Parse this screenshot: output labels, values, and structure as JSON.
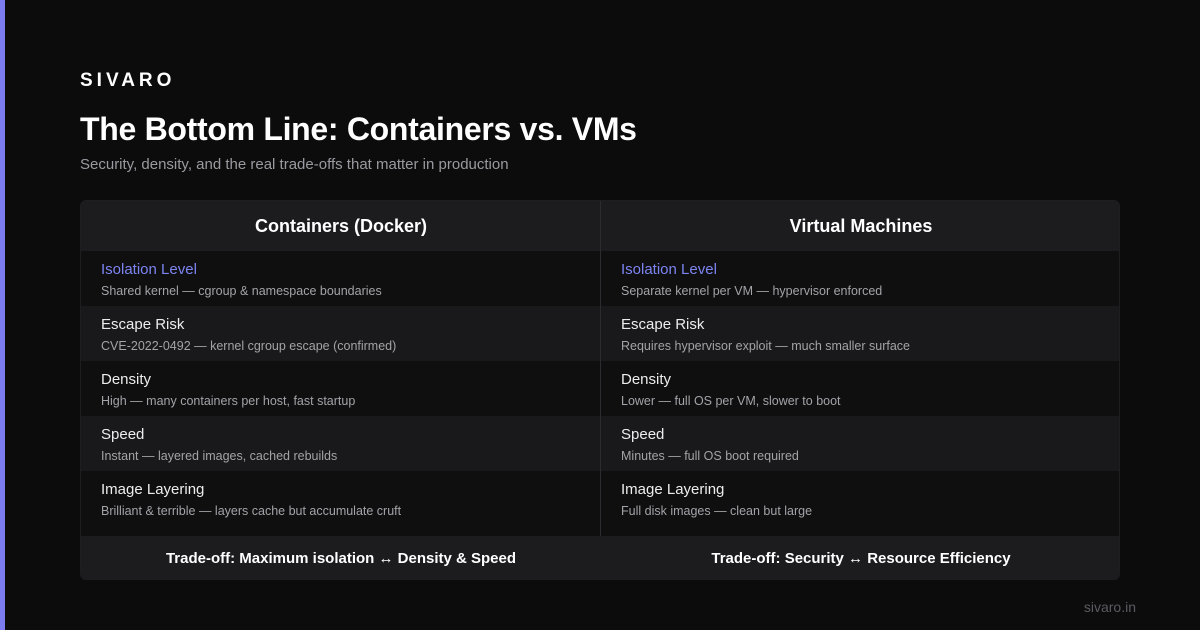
{
  "brand": "SIVARO",
  "title": "The Bottom Line: Containers vs. VMs",
  "subtitle": "Security, density, and the real trade-offs that matter in production",
  "columns": {
    "left": {
      "header": "Containers (Docker)",
      "rows": [
        {
          "label": "Isolation Level",
          "desc": "Shared kernel — cgroup & namespace boundaries"
        },
        {
          "label": "Escape Risk",
          "desc": "CVE-2022-0492 — kernel cgroup escape (confirmed)"
        },
        {
          "label": "Density",
          "desc": "High — many containers per host, fast startup"
        },
        {
          "label": "Speed",
          "desc": "Instant — layered images, cached rebuilds"
        },
        {
          "label": "Image Layering",
          "desc": "Brilliant & terrible — layers cache but accumulate cruft"
        }
      ],
      "footer": "Trade-off: Maximum isolation ↔ Density & Speed"
    },
    "right": {
      "header": "Virtual Machines",
      "rows": [
        {
          "label": "Isolation Level",
          "desc": "Separate kernel per VM — hypervisor enforced"
        },
        {
          "label": "Escape Risk",
          "desc": "Requires hypervisor exploit — much smaller surface"
        },
        {
          "label": "Density",
          "desc": "Lower — full OS per VM, slower to boot"
        },
        {
          "label": "Speed",
          "desc": "Minutes — full OS boot required"
        },
        {
          "label": "Image Layering",
          "desc": "Full disk images — clean but large"
        }
      ],
      "footer": "Trade-off: Security ↔ Resource Efficiency"
    }
  },
  "site": "sivaro.in",
  "colors": {
    "background": "#0c0c0d",
    "accent": "#7c7cf0",
    "highlight_label": "#7c84f0"
  }
}
